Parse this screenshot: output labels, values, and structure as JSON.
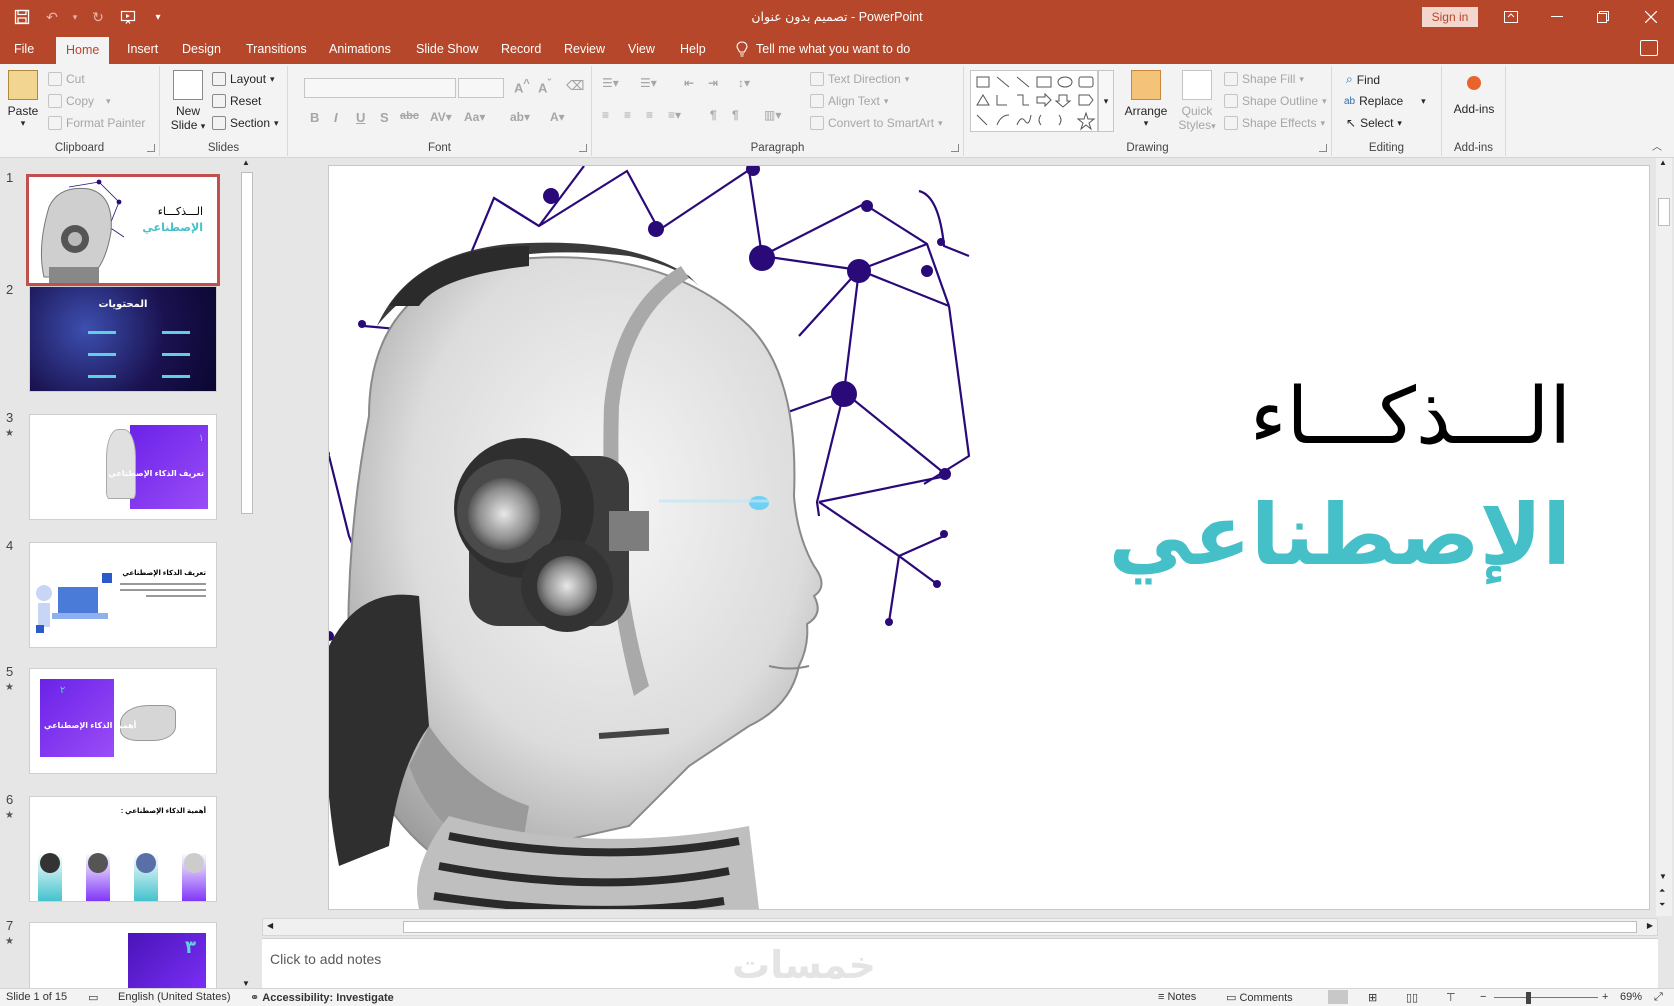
{
  "app": {
    "document_title": "تصميم بدون عنوان",
    "app_name": "PowerPoint",
    "title_separator": "-",
    "sign_in": "Sign in"
  },
  "tabs": [
    "File",
    "Home",
    "Insert",
    "Design",
    "Transitions",
    "Animations",
    "Slide Show",
    "Record",
    "Review",
    "View",
    "Help"
  ],
  "tell_me": "Tell me what you want to do",
  "ribbon": {
    "clipboard": {
      "label": "Clipboard",
      "paste": "Paste",
      "cut": "Cut",
      "copy": "Copy",
      "format_painter": "Format Painter"
    },
    "slides": {
      "label": "Slides",
      "new_slide_line1": "New",
      "new_slide_line2": "Slide",
      "layout": "Layout",
      "reset": "Reset",
      "section": "Section"
    },
    "font": {
      "label": "Font"
    },
    "paragraph": {
      "label": "Paragraph",
      "text_direction": "Text Direction",
      "align_text": "Align Text",
      "convert_smartart": "Convert to SmartArt"
    },
    "drawing": {
      "label": "Drawing",
      "arrange": "Arrange",
      "quick_styles_line1": "Quick",
      "quick_styles_line2": "Styles",
      "shape_fill": "Shape Fill",
      "shape_outline": "Shape Outline",
      "shape_effects": "Shape Effects"
    },
    "editing": {
      "label": "Editing",
      "find": "Find",
      "replace": "Replace",
      "select": "Select"
    },
    "addins": {
      "label": "Add-ins",
      "button": "Add-ins"
    }
  },
  "thumbnails": [
    {
      "num": "1",
      "star": false,
      "title1": "الـــذكـــاء",
      "title2": "الإصطناعي"
    },
    {
      "num": "2",
      "star": false,
      "title1": "المحتويات"
    },
    {
      "num": "3",
      "star": true,
      "title1": "تعريف الذكاء الإصطناعي",
      "badge": "١"
    },
    {
      "num": "4",
      "star": false,
      "title1": "تعريف الذكاء الإصطناعي"
    },
    {
      "num": "5",
      "star": true,
      "title1": "أهمية الذكاء الإصطناعي",
      "badge": "٢"
    },
    {
      "num": "6",
      "star": true,
      "title1": "أهمية الذكاء الإصطناعي :"
    },
    {
      "num": "7",
      "star": true,
      "badge": "٣"
    }
  ],
  "slide": {
    "title_line1": "الـــذكـــاء",
    "title_line2": "الإصطناعي"
  },
  "notes_placeholder": "Click to add notes",
  "watermark": "خمسات",
  "status": {
    "slide_of": "Slide 1 of 15",
    "language": "English (United States)",
    "accessibility": "Accessibility: Investigate",
    "notes": "Notes",
    "comments": "Comments",
    "zoom": "69%"
  },
  "colors": {
    "accent": "#b7472a",
    "title_teal": "#45c0c8",
    "network_purple": "#2a0a78",
    "thumb_purple": "#7b2ff7"
  }
}
